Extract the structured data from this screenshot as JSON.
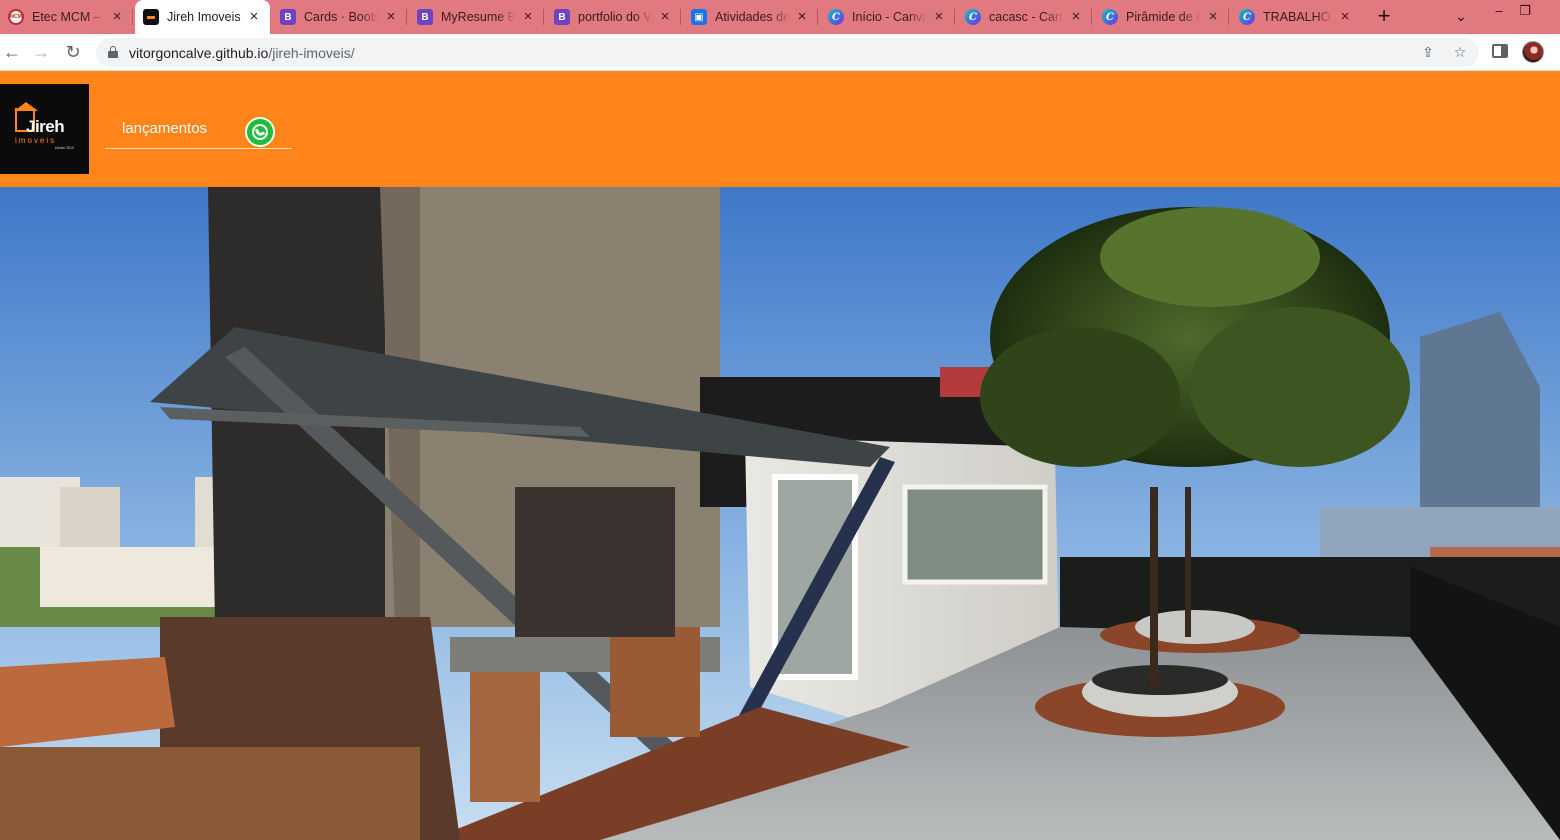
{
  "browser": {
    "tabs": [
      {
        "title": "Etec MCM – Etec Mariano Cristóvão Machado",
        "favicon": "etec-icon",
        "active": false
      },
      {
        "title": "Jireh Imoveis",
        "favicon": "jireh-icon",
        "active": true
      },
      {
        "title": "Cards · Bootstrap",
        "favicon": "bootstrap-icon",
        "active": false
      },
      {
        "title": "MyResume Bootstrap",
        "favicon": "bootstrap-icon",
        "active": false
      },
      {
        "title": "portfolio do Vitor",
        "favicon": "bootstrap-icon",
        "active": false
      },
      {
        "title": "Atividades de",
        "favicon": "classroom-icon",
        "active": false
      },
      {
        "title": "Início - Canva",
        "favicon": "canva-icon",
        "active": false
      },
      {
        "title": "cacasc - Cartaz",
        "favicon": "canva-icon",
        "active": false
      },
      {
        "title": "Pirâmide de Comunicação",
        "favicon": "canva-icon",
        "active": false
      },
      {
        "title": "TRABALHO PI",
        "favicon": "canva-icon",
        "active": false
      }
    ],
    "new_tab_symbol": "+",
    "tab_search_symbol": "⌄",
    "window_controls": {
      "minimize": "–",
      "restore": "❐"
    },
    "nav": {
      "back": "←",
      "forward": "→",
      "reload": "↻"
    },
    "address": {
      "host": "vitorgoncalve.github.io",
      "path": "/jireh-imoveis/"
    },
    "omnibox_icons": {
      "share": "⇪",
      "bookmark": "☆"
    }
  },
  "site": {
    "accent": "#ff8419",
    "logo": {
      "name": "Jireh",
      "sub": "imoveis",
      "tag": "Desde 2019"
    },
    "nav_link": "lançamentos",
    "whatsapp_icon": "whatsapp-icon"
  }
}
